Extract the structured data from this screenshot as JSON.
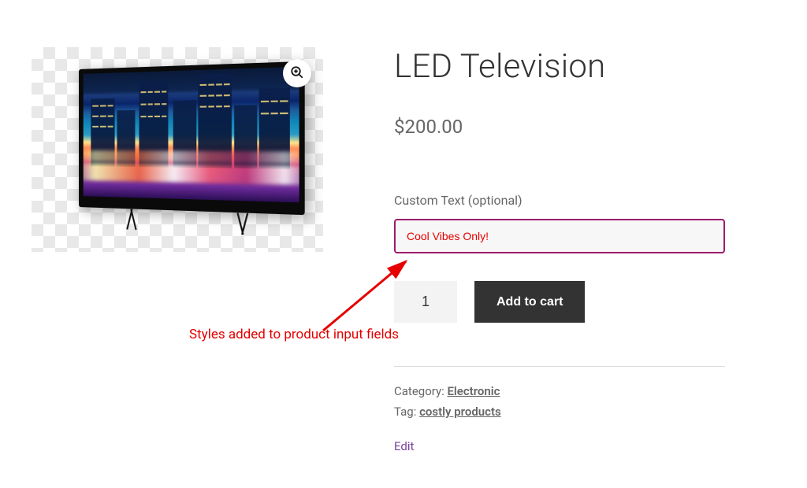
{
  "product": {
    "title": "LED Television",
    "price": "$200.00"
  },
  "custom_field": {
    "label": "Custom Text (optional)",
    "value": "Cool Vibes Only!"
  },
  "cart": {
    "quantity": "1",
    "button_label": "Add to cart"
  },
  "meta": {
    "category_label": "Category: ",
    "category_link": "Electronic",
    "tag_label": "Tag: ",
    "tag_link": "costly products"
  },
  "edit_label": "Edit",
  "annotation": "Styles added to product input fields"
}
